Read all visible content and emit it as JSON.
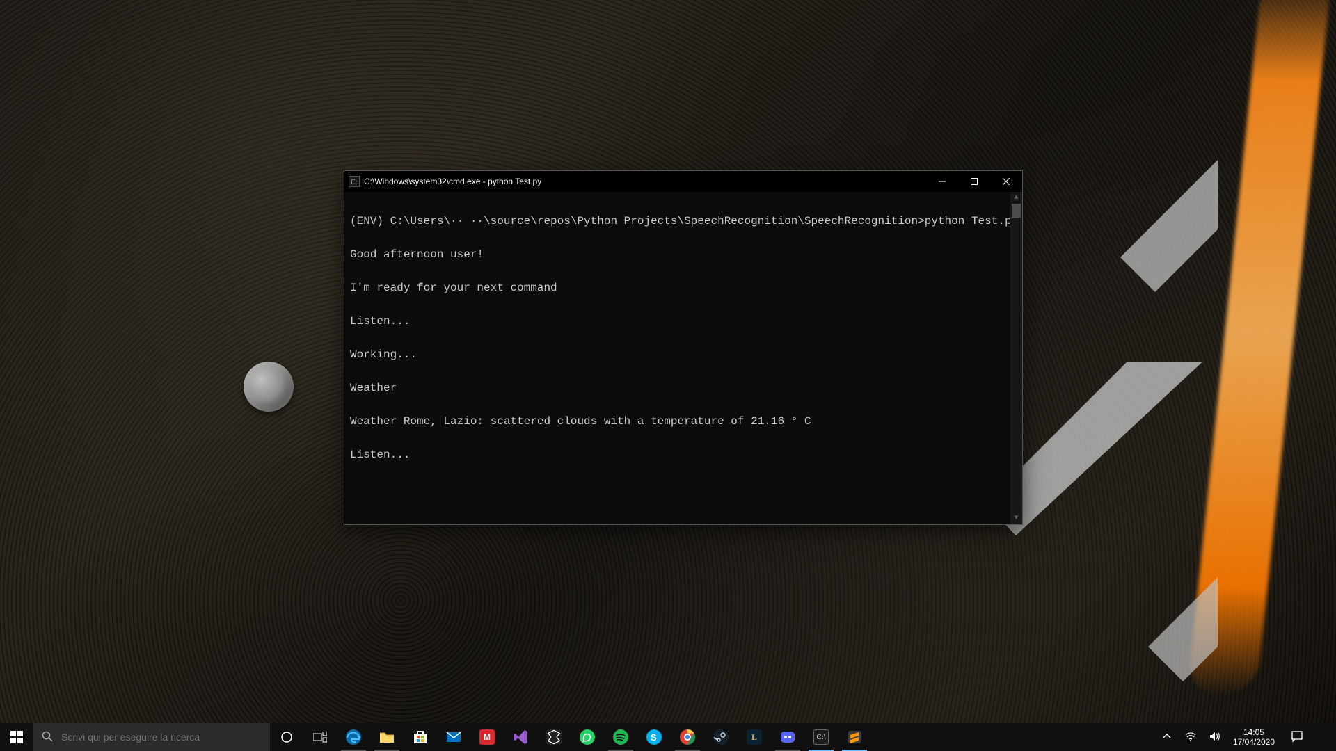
{
  "cmd": {
    "title": "C:\\Windows\\system32\\cmd.exe - python  Test.py",
    "lines": [
      "(ENV) C:\\Users\\·· ··\\source\\repos\\Python Projects\\SpeechRecognition\\SpeechRecognition>python Test.py",
      "Good afternoon user!",
      "I'm ready for your next command",
      "Listen...",
      "Working...",
      "Weather",
      "Weather Rome, Lazio: scattered clouds with a temperature of 21.16 ° C",
      "Listen..."
    ]
  },
  "taskbar": {
    "search_placeholder": "Scrivi qui per eseguire la ricerca",
    "apps": [
      {
        "name": "edge",
        "label": "Edge"
      },
      {
        "name": "file-explorer",
        "label": "Explorer"
      },
      {
        "name": "ms-store",
        "label": "Store"
      },
      {
        "name": "mail",
        "label": "Mail"
      },
      {
        "name": "mega",
        "label": "MEGA"
      },
      {
        "name": "visual-studio",
        "label": "VS"
      },
      {
        "name": "unity",
        "label": "Unity"
      },
      {
        "name": "whatsapp",
        "label": "WhatsApp"
      },
      {
        "name": "spotify",
        "label": "Spotify"
      },
      {
        "name": "skype",
        "label": "Skype"
      },
      {
        "name": "chrome",
        "label": "Chrome"
      },
      {
        "name": "steam",
        "label": "Steam"
      },
      {
        "name": "league",
        "label": "LoL"
      },
      {
        "name": "discord",
        "label": "Discord"
      },
      {
        "name": "cmd",
        "label": "cmd"
      },
      {
        "name": "sublime",
        "label": "Sublime"
      }
    ]
  },
  "tray": {
    "time": "14:05",
    "date": "17/04/2020"
  },
  "colors": {
    "accent": "#76b9ed",
    "terminal_bg": "#0c0c0c",
    "terminal_fg": "#cccccc"
  }
}
